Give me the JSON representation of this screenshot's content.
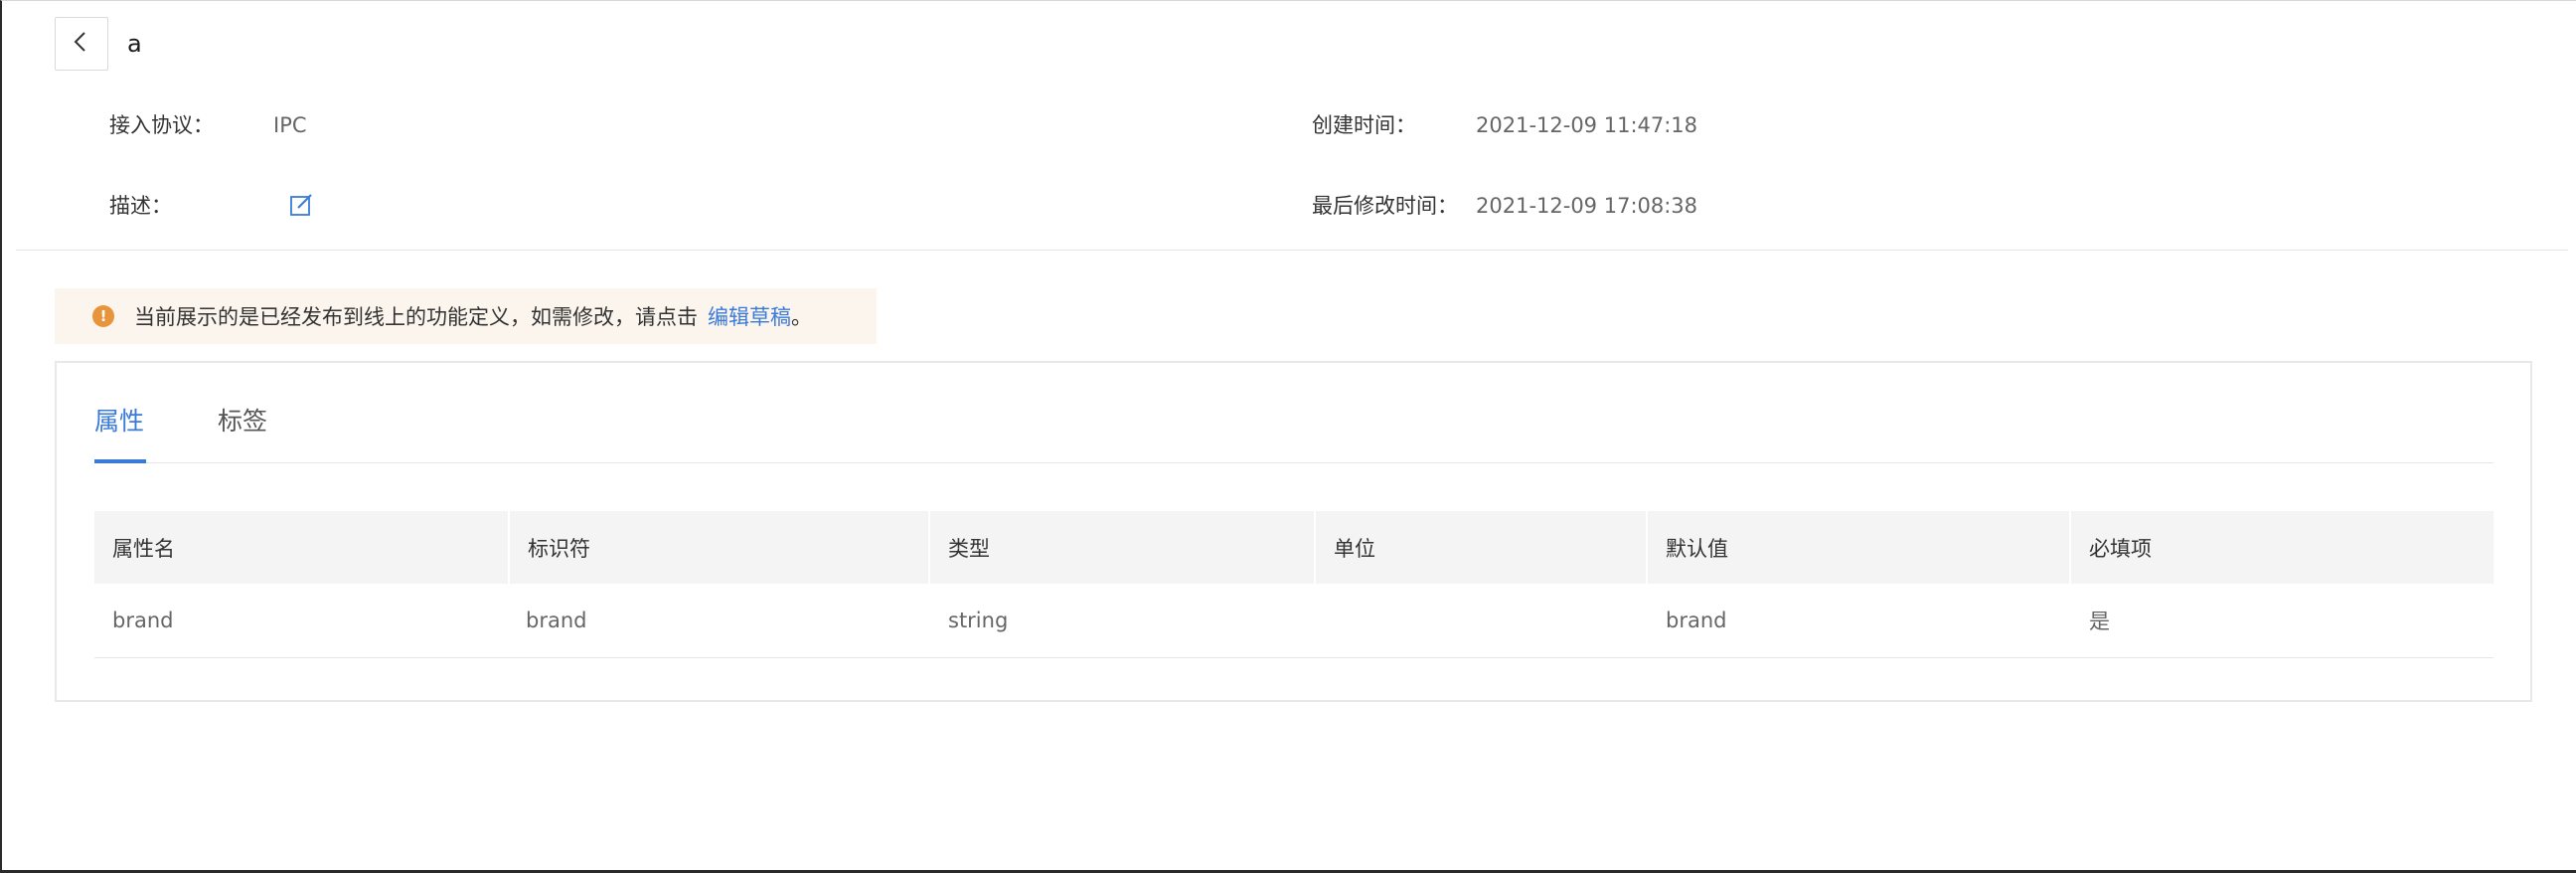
{
  "header": {
    "title": "a",
    "back_icon": "chevron-left-icon"
  },
  "info": {
    "protocol_label": "接入协议：",
    "protocol_value": "IPC",
    "created_label": "创建时间：",
    "created_value": "2021-12-09 11:47:18",
    "description_label": "描述：",
    "description_edit_icon": "edit-icon",
    "modified_label": "最后修改时间：",
    "modified_value": "2021-12-09 17:08:38"
  },
  "notice": {
    "icon": "exclamation-icon",
    "text": "当前展示的是已经发布到线上的功能定义，如需修改，请点击",
    "link": "编辑草稿",
    "end": "。"
  },
  "tabs": [
    {
      "label": "属性",
      "active": true
    },
    {
      "label": "标签",
      "active": false
    }
  ],
  "table": {
    "columns": [
      "属性名",
      "标识符",
      "类型",
      "单位",
      "默认值",
      "必填项"
    ],
    "rows": [
      [
        "brand",
        "brand",
        "string",
        "",
        "brand",
        "是"
      ]
    ]
  },
  "colors": {
    "accent": "#3a7ad9",
    "notice_bg": "#fbf5ee",
    "warning": "#e8943a",
    "table_header_bg": "#f4f4f4"
  }
}
